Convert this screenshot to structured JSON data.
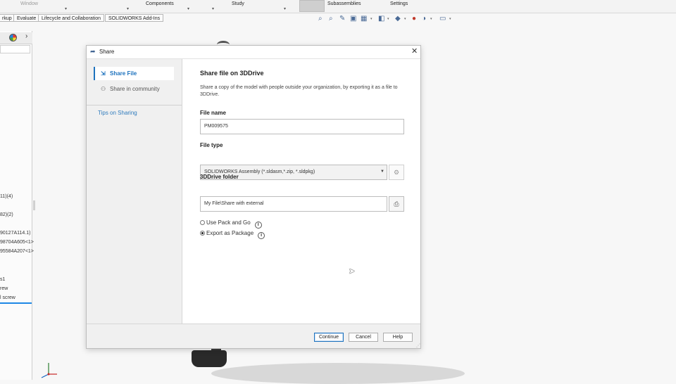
{
  "ribbon": {
    "labels": [
      "Window",
      "Components",
      "Study",
      "Subassemblies",
      "Settings"
    ]
  },
  "tabs": [
    "rkup",
    "Evaluate",
    "Lifecycle and Collaboration",
    "SOLIDWORKS Add-Ins"
  ],
  "feature_tree": {
    "items": [
      "11)(4)",
      "82)(2)",
      "90127A114.1)",
      "98704A605<1>",
      "95584A207<1>",
      "s1",
      "rew",
      "l screw"
    ]
  },
  "dialog": {
    "title": "Share",
    "close_glyph": "✕",
    "nav": {
      "share_file": "Share File",
      "share_community": "Share in community",
      "tips": "Tips on Sharing"
    },
    "heading": "Share file on 3DDrive",
    "description": "Share a copy of the model with people outside your organization, by exporting it as a file to 3DDrive.",
    "file_name": {
      "label": "File name",
      "value": "PM009575"
    },
    "file_type": {
      "label": "File type",
      "value": "SOLIDWORKS Assembly (*.sldasm,*.zip, *.sldpkg)"
    },
    "folder": {
      "label": "3DDrive folder",
      "value": "My File\\Share with external"
    },
    "options": {
      "pack_and_go": "Use Pack and Go",
      "export_package": "Export as Package",
      "selected": "export_package"
    },
    "buttons": {
      "continue": "Continue",
      "cancel": "Cancel",
      "help": "Help"
    }
  },
  "icons": {
    "title": "share-arrow-icon",
    "share_file": "share-file-icon",
    "community": "community-icon",
    "gear": "gear-icon",
    "folder": "folder-browse-icon",
    "info": "info-icon"
  },
  "colors": {
    "accent": "#1e73be",
    "link": "#2f7bbd"
  }
}
